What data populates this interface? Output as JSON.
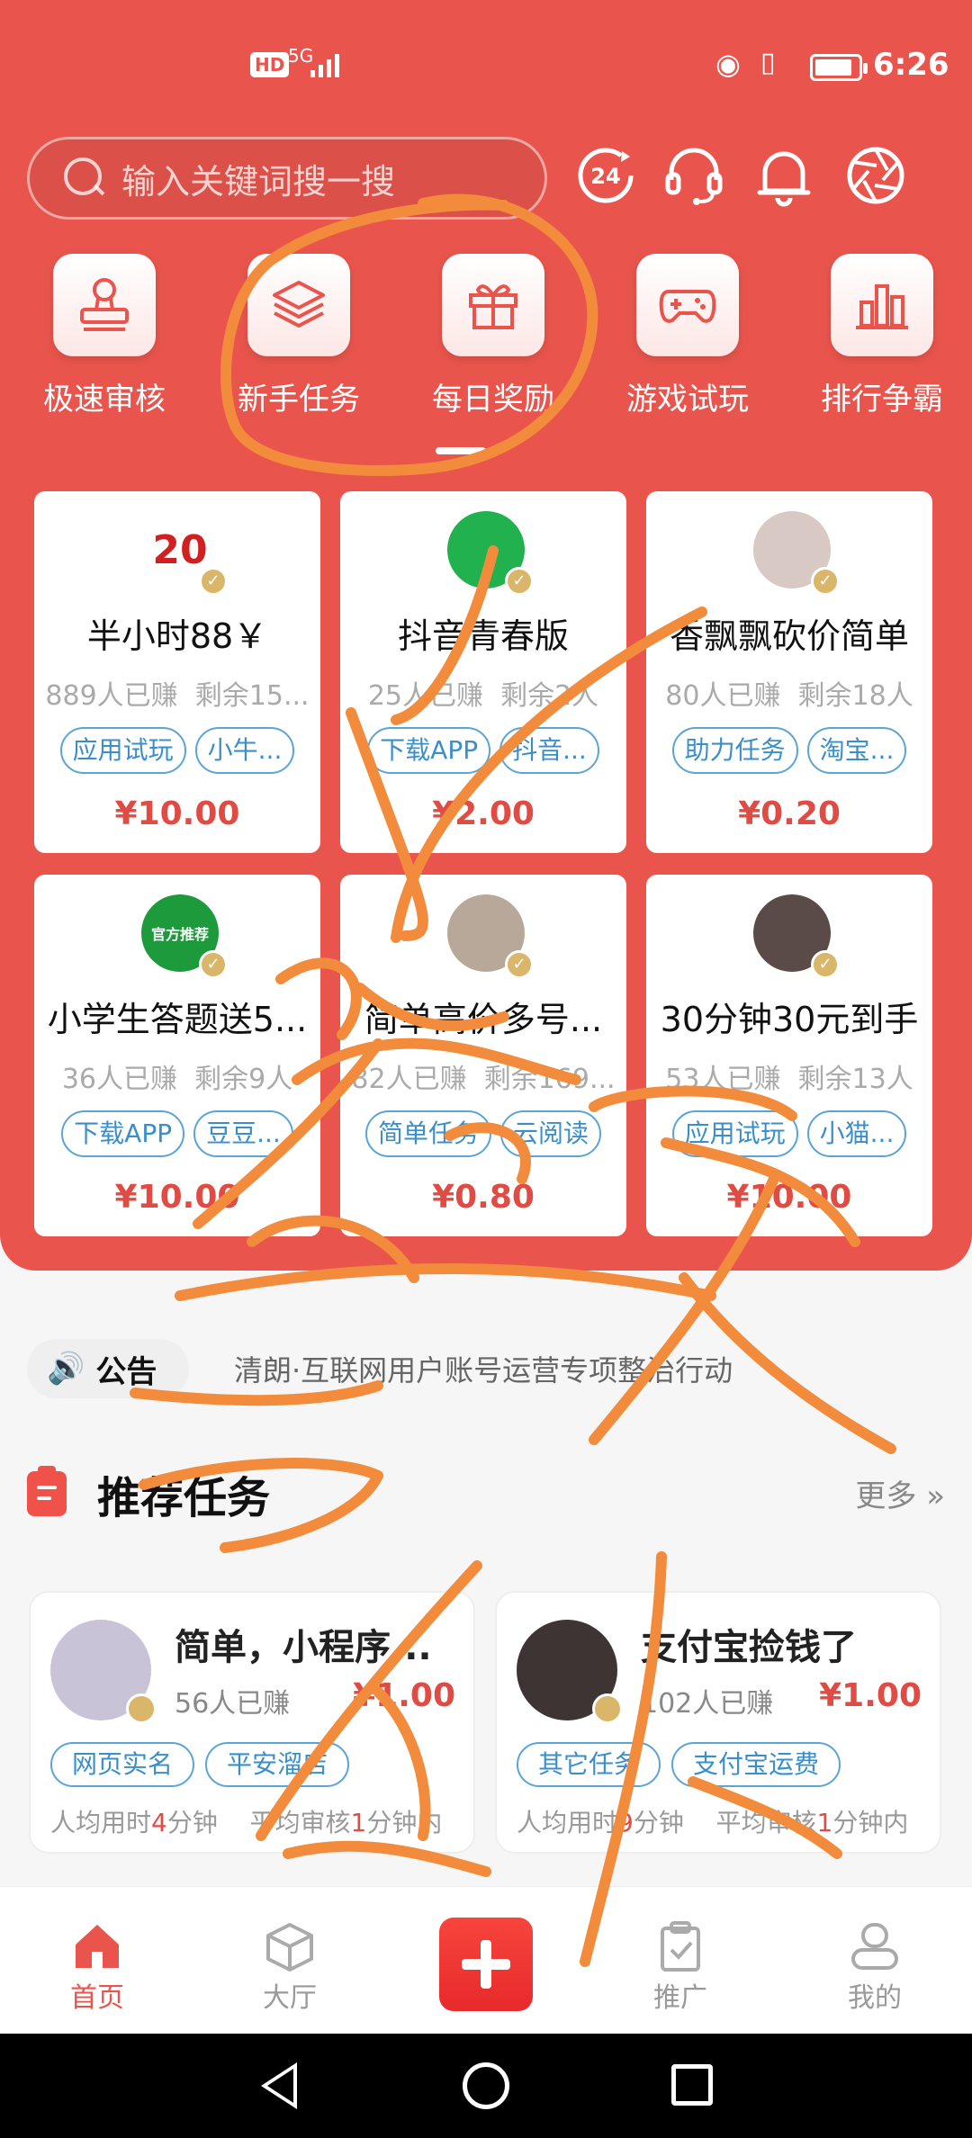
{
  "status_bar": {
    "hd": "HD",
    "network": "5G",
    "time": "6:26"
  },
  "search": {
    "placeholder": "输入关键词搜一搜"
  },
  "header_icons": [
    "refresh-24-icon",
    "headset-icon",
    "bell-icon",
    "aperture-icon"
  ],
  "categories": [
    {
      "label": "极速审核",
      "icon": "stamp-icon"
    },
    {
      "label": "新手任务",
      "icon": "layers-icon"
    },
    {
      "label": "每日奖励",
      "icon": "gift-icon"
    },
    {
      "label": "游戏试玩",
      "icon": "gamepad-icon"
    },
    {
      "label": "排行争霸",
      "icon": "bar-chart-icon"
    }
  ],
  "tasks": [
    {
      "title": "半小时88￥",
      "earned": "889人已赚",
      "remain": "剩余15...",
      "tags": [
        "应用试玩",
        "小牛..."
      ],
      "price": "¥10.00",
      "avatar_text": "20",
      "avatar_color": "#ffffff"
    },
    {
      "title": "抖音青春版",
      "earned": "25人已赚",
      "remain": "剩余2人",
      "tags": [
        "下载APP",
        "抖音..."
      ],
      "price": "¥2.00",
      "avatar_text": "",
      "avatar_color": "#21b14e"
    },
    {
      "title": "香飘飘砍价简单",
      "earned": "80人已赚",
      "remain": "剩余18人",
      "tags": [
        "助力任务",
        "淘宝..."
      ],
      "price": "¥0.20",
      "avatar_text": "",
      "avatar_color": "#d9c9c4"
    },
    {
      "title": "小学生答题送5...",
      "earned": "36人已赚",
      "remain": "剩余9人",
      "tags": [
        "下载APP",
        "豆豆..."
      ],
      "price": "¥10.00",
      "avatar_text": "官方推荐",
      "avatar_color": "#1d9b3c"
    },
    {
      "title": "简单高价多号...",
      "earned": "82人已赚",
      "remain": "剩余169...",
      "tags": [
        "简单任务",
        "云阅读"
      ],
      "price": "¥0.80",
      "avatar_text": "",
      "avatar_color": "#b8a89a"
    },
    {
      "title": "30分钟30元到手",
      "earned": "53人已赚",
      "remain": "剩余13人",
      "tags": [
        "应用试玩",
        "小猫..."
      ],
      "price": "¥10.00",
      "avatar_text": "",
      "avatar_color": "#5a4a48"
    }
  ],
  "notice": {
    "label": "公告",
    "text": "清朗·互联网用户账号运营专项整治行动"
  },
  "recommend": {
    "title": "推荐任务",
    "more": "更多",
    "items": [
      {
        "title": "简单，小程序...",
        "count": "56人已赚",
        "price": "¥1.00",
        "tags": [
          "网页实名",
          "平安溜店"
        ],
        "time_prefix": "人均用时",
        "time_value": "4",
        "time_suffix": "分钟",
        "review_prefix": "平均审核",
        "review_value": "1",
        "review_suffix": "分钟内",
        "avatar_color": "#c9c3d8"
      },
      {
        "title": "支付宝捡钱了",
        "count": "102人已赚",
        "price": "¥1.00",
        "tags": [
          "其它任务",
          "支付宝运费"
        ],
        "time_prefix": "人均用时",
        "time_value": "9",
        "time_suffix": "分钟",
        "review_prefix": "平均审核",
        "review_value": "1",
        "review_suffix": "分钟内",
        "avatar_color": "#3d3433"
      }
    ]
  },
  "bottom_nav": [
    {
      "label": "首页",
      "icon": "home-icon",
      "active": true
    },
    {
      "label": "大厅",
      "icon": "cube-icon",
      "active": false
    },
    {
      "label": "",
      "icon": "plus-icon",
      "active": false
    },
    {
      "label": "推广",
      "icon": "clipboard-check-icon",
      "active": false
    },
    {
      "label": "我的",
      "icon": "user-icon",
      "active": false
    }
  ],
  "colors": {
    "primary": "#e9554d",
    "price": "#e04b43",
    "tag": "#3a8fcb",
    "scribble": "#f28c3c"
  }
}
